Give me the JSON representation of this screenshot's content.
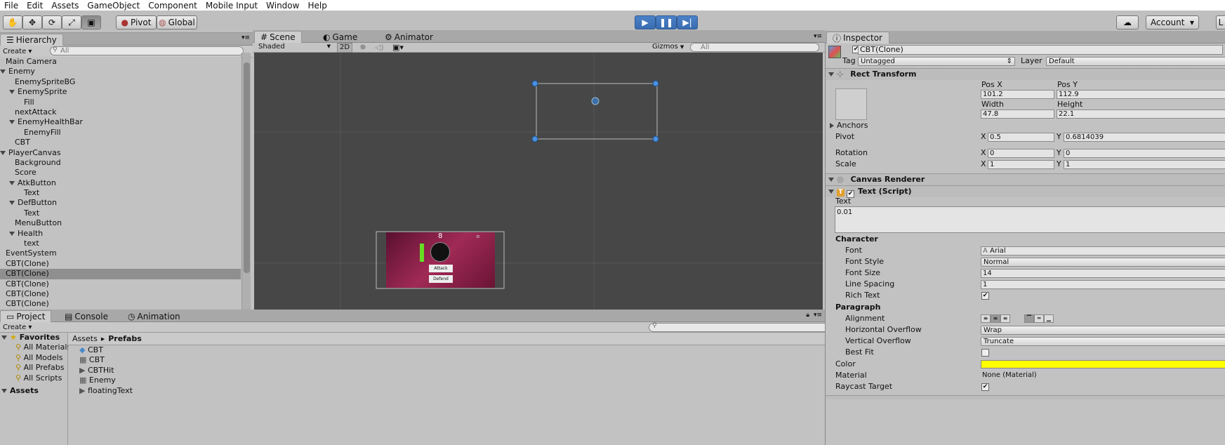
{
  "menu": [
    "File",
    "Edit",
    "Assets",
    "GameObject",
    "Component",
    "Mobile Input",
    "Window",
    "Help"
  ],
  "toolbar": {
    "pivot": "Pivot",
    "global": "Global",
    "account": "Account",
    "layers_initial": "L"
  },
  "hierarchy": {
    "tab": "Hierarchy",
    "create": "Create",
    "search": "All",
    "items": [
      {
        "label": "Main Camera",
        "indent": 0,
        "arrow": ""
      },
      {
        "label": "Enemy",
        "indent": 0,
        "arrow": "down"
      },
      {
        "label": "EnemySpriteBG",
        "indent": 1,
        "arrow": ""
      },
      {
        "label": "EnemySprite",
        "indent": 1,
        "arrow": "down"
      },
      {
        "label": "Fill",
        "indent": 2,
        "arrow": ""
      },
      {
        "label": "nextAttack",
        "indent": 1,
        "arrow": ""
      },
      {
        "label": "EnemyHealthBar",
        "indent": 1,
        "arrow": "down"
      },
      {
        "label": "EnemyFill",
        "indent": 2,
        "arrow": ""
      },
      {
        "label": "CBT",
        "indent": 1,
        "arrow": ""
      },
      {
        "label": "PlayerCanvas",
        "indent": 0,
        "arrow": "down"
      },
      {
        "label": "Background",
        "indent": 1,
        "arrow": ""
      },
      {
        "label": "Score",
        "indent": 1,
        "arrow": ""
      },
      {
        "label": "AtkButton",
        "indent": 1,
        "arrow": "down"
      },
      {
        "label": "Text",
        "indent": 2,
        "arrow": ""
      },
      {
        "label": "DefButton",
        "indent": 1,
        "arrow": "down"
      },
      {
        "label": "Text",
        "indent": 2,
        "arrow": ""
      },
      {
        "label": "MenuButton",
        "indent": 1,
        "arrow": ""
      },
      {
        "label": "Health",
        "indent": 1,
        "arrow": "down"
      },
      {
        "label": "text",
        "indent": 2,
        "arrow": ""
      },
      {
        "label": "EventSystem",
        "indent": 0,
        "arrow": ""
      },
      {
        "label": "CBT(Clone)",
        "indent": 0,
        "arrow": ""
      },
      {
        "label": "CBT(Clone)",
        "indent": 0,
        "arrow": "",
        "selected": true
      },
      {
        "label": "CBT(Clone)",
        "indent": 0,
        "arrow": ""
      },
      {
        "label": "CBT(Clone)",
        "indent": 0,
        "arrow": ""
      },
      {
        "label": "CBT(Clone)",
        "indent": 0,
        "arrow": ""
      }
    ]
  },
  "scene": {
    "tabs": [
      "Scene",
      "Game",
      "Animator"
    ],
    "shading": "Shaded",
    "mode2d": "2D",
    "gizmos": "Gizmos",
    "search": "All",
    "preview": {
      "score": "8",
      "attack": "Attack",
      "defend": "Defend"
    }
  },
  "project": {
    "tabs": [
      "Project",
      "Console",
      "Animation"
    ],
    "create": "Create",
    "favorites_title": "Favorites",
    "favorites": [
      "All Materials",
      "All Models",
      "All Prefabs",
      "All Scripts"
    ],
    "assets_title": "Assets",
    "breadcrumb": [
      "Assets",
      "Prefabs"
    ],
    "files": [
      "CBT",
      "CBT",
      "CBTHit",
      "Enemy",
      "floatingText"
    ]
  },
  "inspector": {
    "tab": "Inspector",
    "object_name": "CBT(Clone)",
    "tag_label": "Tag",
    "tag": "Untagged",
    "layer_label": "Layer",
    "layer": "Default",
    "rect": {
      "title": "Rect Transform",
      "posx_label": "Pos X",
      "posy_label": "Pos Y",
      "posx": "101.2",
      "posy": "112.9",
      "width_label": "Width",
      "height_label": "Height",
      "width": "47.8",
      "height": "22.1",
      "anchors": "Anchors",
      "pivot": "Pivot",
      "pivot_x": "0.5",
      "pivot_y": "0.6814039",
      "rotation": "Rotation",
      "rot_x": "0",
      "rot_y": "0",
      "scale": "Scale",
      "scale_x": "1",
      "scale_y": "1",
      "x": "X",
      "y": "Y"
    },
    "canvas_renderer": "Canvas Renderer",
    "text_script": {
      "title": "Text (Script)",
      "text_label": "Text",
      "text_value": "0.01",
      "character": "Character",
      "font_label": "Font",
      "font": "Arial",
      "font_style_label": "Font Style",
      "font_style": "Normal",
      "font_size_label": "Font Size",
      "font_size": "14",
      "line_spacing_label": "Line Spacing",
      "line_spacing": "1",
      "rich_text_label": "Rich Text",
      "paragraph": "Paragraph",
      "alignment_label": "Alignment",
      "h_overflow_label": "Horizontal Overflow",
      "h_overflow": "Wrap",
      "v_overflow_label": "Vertical Overflow",
      "v_overflow": "Truncate",
      "best_fit_label": "Best Fit",
      "color_label": "Color",
      "color": "#ffff00",
      "material_label": "Material",
      "material": "None (Material)",
      "raycast_label": "Raycast Target"
    }
  },
  "colors": {
    "play_blue": "#3a6cb0",
    "selection": "#8f8f8f",
    "scene_bg": "#474747",
    "preview_bg": "#7a1a3c"
  }
}
